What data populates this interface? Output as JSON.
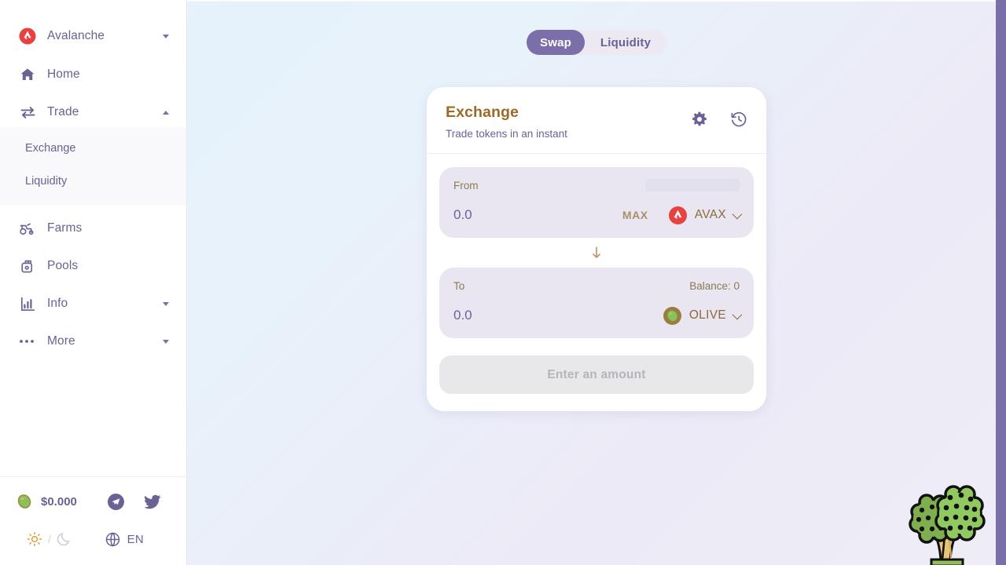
{
  "sidebar": {
    "brand": {
      "label": "Avalanche",
      "icon": "avalanche-logo-icon",
      "caret": "chevron-down-icon"
    },
    "items": [
      {
        "label": "Home",
        "icon": "home-icon",
        "caret": null,
        "active": false
      },
      {
        "label": "Trade",
        "icon": "swap-arrows-icon",
        "caret": "chevron-up-icon",
        "active": true
      },
      {
        "label": "Farms",
        "icon": "tractor-icon",
        "caret": null,
        "active": false
      },
      {
        "label": "Pools",
        "icon": "pool-jar-icon",
        "caret": null,
        "active": false
      },
      {
        "label": "Info",
        "icon": "bar-chart-icon",
        "caret": "chevron-down-icon",
        "active": false
      },
      {
        "label": "More",
        "icon": "ellipsis-icon",
        "caret": "chevron-down-icon",
        "active": false
      }
    ],
    "submenu": [
      {
        "label": "Exchange",
        "active": true
      },
      {
        "label": "Liquidity",
        "active": false
      }
    ],
    "footer": {
      "token_icon": "olive-icon",
      "price": "$0.000",
      "socials": [
        {
          "name": "telegram-icon"
        },
        {
          "name": "twitter-icon"
        }
      ],
      "theme": {
        "light_icon": "sun-icon",
        "separator": "/",
        "dark_icon": "moon-icon",
        "active": "light"
      },
      "language": {
        "icon": "globe-icon",
        "label": "EN"
      }
    }
  },
  "main": {
    "toggle": {
      "options": [
        {
          "label": "Swap",
          "active": true
        },
        {
          "label": "Liquidity",
          "active": false
        }
      ]
    },
    "card": {
      "title": "Exchange",
      "subtitle": "Trade tokens in an instant",
      "header_icons": [
        {
          "name": "gear-icon"
        },
        {
          "name": "history-icon"
        }
      ],
      "from": {
        "label": "From",
        "amount": "0.0",
        "placeholder": "0.0",
        "max_label": "MAX",
        "balance_loading": true,
        "token": {
          "symbol": "AVAX",
          "icon": "avalanche-token-icon"
        }
      },
      "swap_direction_icon": "arrow-down-icon",
      "to": {
        "label": "To",
        "balance": "Balance: 0",
        "amount": "0.0",
        "placeholder": "0.0",
        "token": {
          "symbol": "OLIVE",
          "icon": "olive-token-icon"
        }
      },
      "submit": {
        "label": "Enter an amount",
        "disabled": true
      }
    },
    "decoration": {
      "name": "olive-tree-illustration"
    }
  },
  "colors": {
    "purple": "#6b6194",
    "purple_accent": "#7a6fa8",
    "brown": "#9c6a26",
    "gold": "#a89165",
    "panel_bg": "#e9e6f2",
    "avalanche_red": "#e84142",
    "olive_green": "#7ab648",
    "disabled_btn": "#e8e8ea"
  }
}
